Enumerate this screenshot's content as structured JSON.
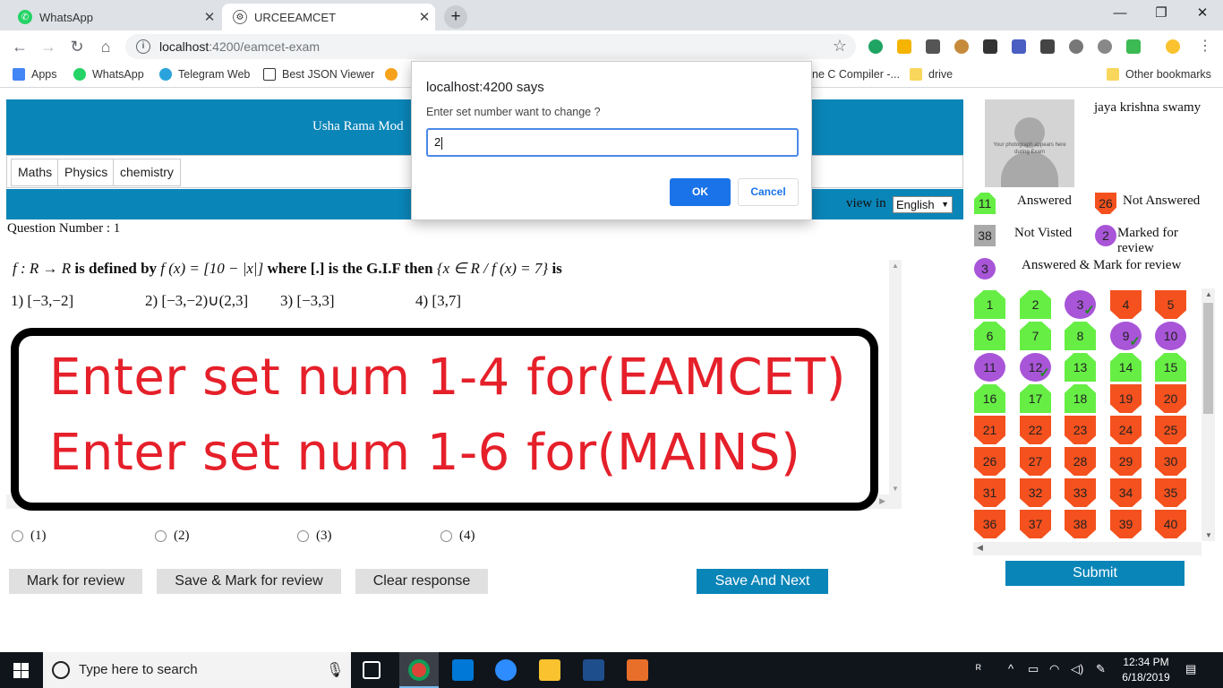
{
  "browser": {
    "tabs": [
      {
        "title": "WhatsApp",
        "icon": "whatsapp-icon",
        "active": false
      },
      {
        "title": "URCEEAMCET",
        "icon": "site-icon",
        "active": true
      }
    ],
    "url_host": "localhost",
    "url_path": ":4200/eamcet-exam",
    "bookmarks": [
      {
        "label": "Apps",
        "icon": "apps-grid-icon"
      },
      {
        "label": "WhatsApp",
        "icon": "whatsapp-icon"
      },
      {
        "label": "Telegram Web",
        "icon": "telegram-icon"
      },
      {
        "label": "Best JSON Viewer",
        "icon": "cb-icon"
      },
      {
        "label": "ne C Compiler -...",
        "icon": "compiler-icon"
      },
      {
        "label": "drive",
        "icon": "folder-icon"
      },
      {
        "label": "Other bookmarks",
        "icon": "folder-icon"
      }
    ]
  },
  "exam": {
    "banner_text": "Usha Rama Mod",
    "subjects": [
      "Maths",
      "Physics",
      "chemistry"
    ],
    "view_in_label": "view in",
    "language": "English",
    "question_number_label": "Question Number : 1",
    "question": {
      "part1": "f : R → R",
      "part2": " is defined by ",
      "part3": "f (x) = [10 − |x|]",
      "part4": " where [.] is the G.I.F then ",
      "part5": "{x ∈ R / f (x) = 7}",
      "part6": " is"
    },
    "options": [
      "1) [−3,−2]",
      "2) [−3,−2)∪(2,3]",
      "3)  [−3,3]",
      "4) [3,7]"
    ],
    "notice_lines": [
      "Enter set num 1-4 for(EAMCET)",
      "Enter set num 1-6 for(MAINS)"
    ],
    "answer_choices": [
      "(1)",
      "(2)",
      "(3)",
      "(4)"
    ],
    "actions": {
      "mark_review": "Mark for review",
      "save_mark_review": "Save & Mark for review",
      "clear": "Clear response",
      "save_next": "Save And Next"
    }
  },
  "panel": {
    "photo_text": "Your photograph appears here during Exam",
    "candidate_name": "jaya krishna swamy",
    "legend": {
      "answered": {
        "count": "11",
        "label": "Answered",
        "color": "#66ee44"
      },
      "not_answered": {
        "count": "26",
        "label": "Not Answered",
        "color": "#f4511e"
      },
      "not_visited": {
        "count": "38",
        "label": "Not Visted",
        "color": "#a9a9a9"
      },
      "marked_review": {
        "count": "2",
        "label": "Marked for review",
        "color": "#a855d8"
      },
      "answered_marked": {
        "count": "3",
        "label": "Answered & Mark for review"
      }
    },
    "question_states": [
      "answered",
      "answered",
      "answered-marked",
      "not-answered",
      "not-answered",
      "answered",
      "answered",
      "answered",
      "answered-marked",
      "marked",
      "marked",
      "answered-marked",
      "answered",
      "answered",
      "answered",
      "answered",
      "answered",
      "answered",
      "not-answered",
      "not-answered",
      "not-answered",
      "not-answered",
      "not-answered",
      "not-answered",
      "not-answered",
      "not-answered",
      "not-answered",
      "not-answered",
      "not-answered",
      "not-answered",
      "not-answered",
      "not-answered",
      "not-answered",
      "not-answered",
      "not-answered",
      "not-answered",
      "not-answered",
      "not-answered",
      "not-answered",
      "not-answered"
    ],
    "submit_label": "Submit"
  },
  "dialog": {
    "title": "localhost:4200 says",
    "message": "Enter set number want to change ?",
    "input_value": "2",
    "ok_label": "OK",
    "cancel_label": "Cancel"
  },
  "taskbar": {
    "search_placeholder": "Type here to search",
    "time": "12:34 PM",
    "date": "6/18/2019"
  }
}
